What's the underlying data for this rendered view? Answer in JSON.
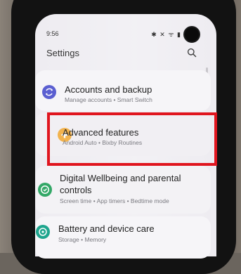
{
  "status_bar": {
    "time": "9:56",
    "icons": "✱ ✕ ᯤ ▮"
  },
  "header": {
    "title": "Settings",
    "search_icon": "search-icon"
  },
  "items": [
    {
      "title": "Accounts and backup",
      "subtitle": "Manage accounts • Smart Switch",
      "icon": "sync-icon",
      "color": "#5b5fd1"
    },
    {
      "title": "Advanced features",
      "subtitle": "Android Auto • Bixby Routines",
      "icon": "gear-plus-icon",
      "color": "#f2b34e"
    },
    {
      "title_line1": "Digital Wellbeing and parental",
      "title_line2": "controls",
      "subtitle": "Screen time • App timers • Bedtime mode",
      "icon": "wellbeing-icon",
      "color": "#33a867"
    },
    {
      "title": "Battery and device care",
      "subtitle": "Storage • Memory",
      "icon": "device-care-icon",
      "color": "#1fa58e"
    }
  ],
  "highlight_color": "#e0151e"
}
